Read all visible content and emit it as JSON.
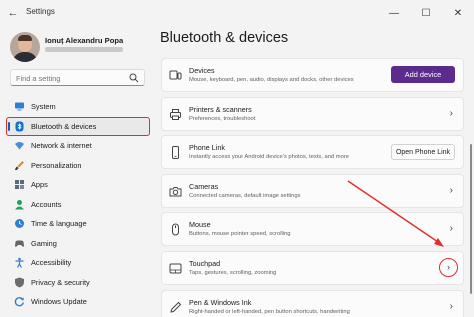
{
  "window": {
    "title": "Settings",
    "controls": [
      "minimize-icon",
      "maximize-icon",
      "close-icon"
    ]
  },
  "user": {
    "name": "Ionuț Alexandru Popa"
  },
  "search": {
    "placeholder": "Find a setting"
  },
  "sidebar": {
    "items": [
      {
        "label": "System",
        "icon": "monitor-icon"
      },
      {
        "label": "Bluetooth & devices",
        "icon": "bluetooth-icon",
        "active": true
      },
      {
        "label": "Network & internet",
        "icon": "wifi-icon"
      },
      {
        "label": "Personalization",
        "icon": "brush-icon"
      },
      {
        "label": "Apps",
        "icon": "apps-grid-icon"
      },
      {
        "label": "Accounts",
        "icon": "person-icon"
      },
      {
        "label": "Time & language",
        "icon": "globe-clock-icon"
      },
      {
        "label": "Gaming",
        "icon": "controller-icon"
      },
      {
        "label": "Accessibility",
        "icon": "accessibility-icon"
      },
      {
        "label": "Privacy & security",
        "icon": "shield-icon"
      },
      {
        "label": "Windows Update",
        "icon": "update-icon"
      }
    ]
  },
  "page": {
    "title": "Bluetooth & devices"
  },
  "cards": [
    {
      "title": "Devices",
      "subtitle": "Mouse, keyboard, pen, audio, displays and docks, other devices",
      "action": "Add device",
      "icon": "devices-icon"
    },
    {
      "title": "Printers & scanners",
      "subtitle": "Preferences, troubleshoot",
      "icon": "printer-icon"
    },
    {
      "title": "Phone Link",
      "subtitle": "Instantly access your Android device's photos, texts, and more",
      "action": "Open Phone Link",
      "icon": "phone-icon"
    },
    {
      "title": "Cameras",
      "subtitle": "Connected cameras, default image settings",
      "icon": "camera-icon"
    },
    {
      "title": "Mouse",
      "subtitle": "Buttons, mouse pointer speed, scrolling",
      "icon": "mouse-icon"
    },
    {
      "title": "Touchpad",
      "subtitle": "Taps, gestures, scrolling, zooming",
      "icon": "touchpad-icon",
      "highlighted": true
    },
    {
      "title": "Pen & Windows Ink",
      "subtitle": "Right-handed or left-handed, pen button shortcuts, handwriting",
      "icon": "pen-icon"
    }
  ],
  "colors": {
    "accent": "#0067c0",
    "primary_button": "#5b2b8e",
    "annotation": "#e02d2d"
  }
}
